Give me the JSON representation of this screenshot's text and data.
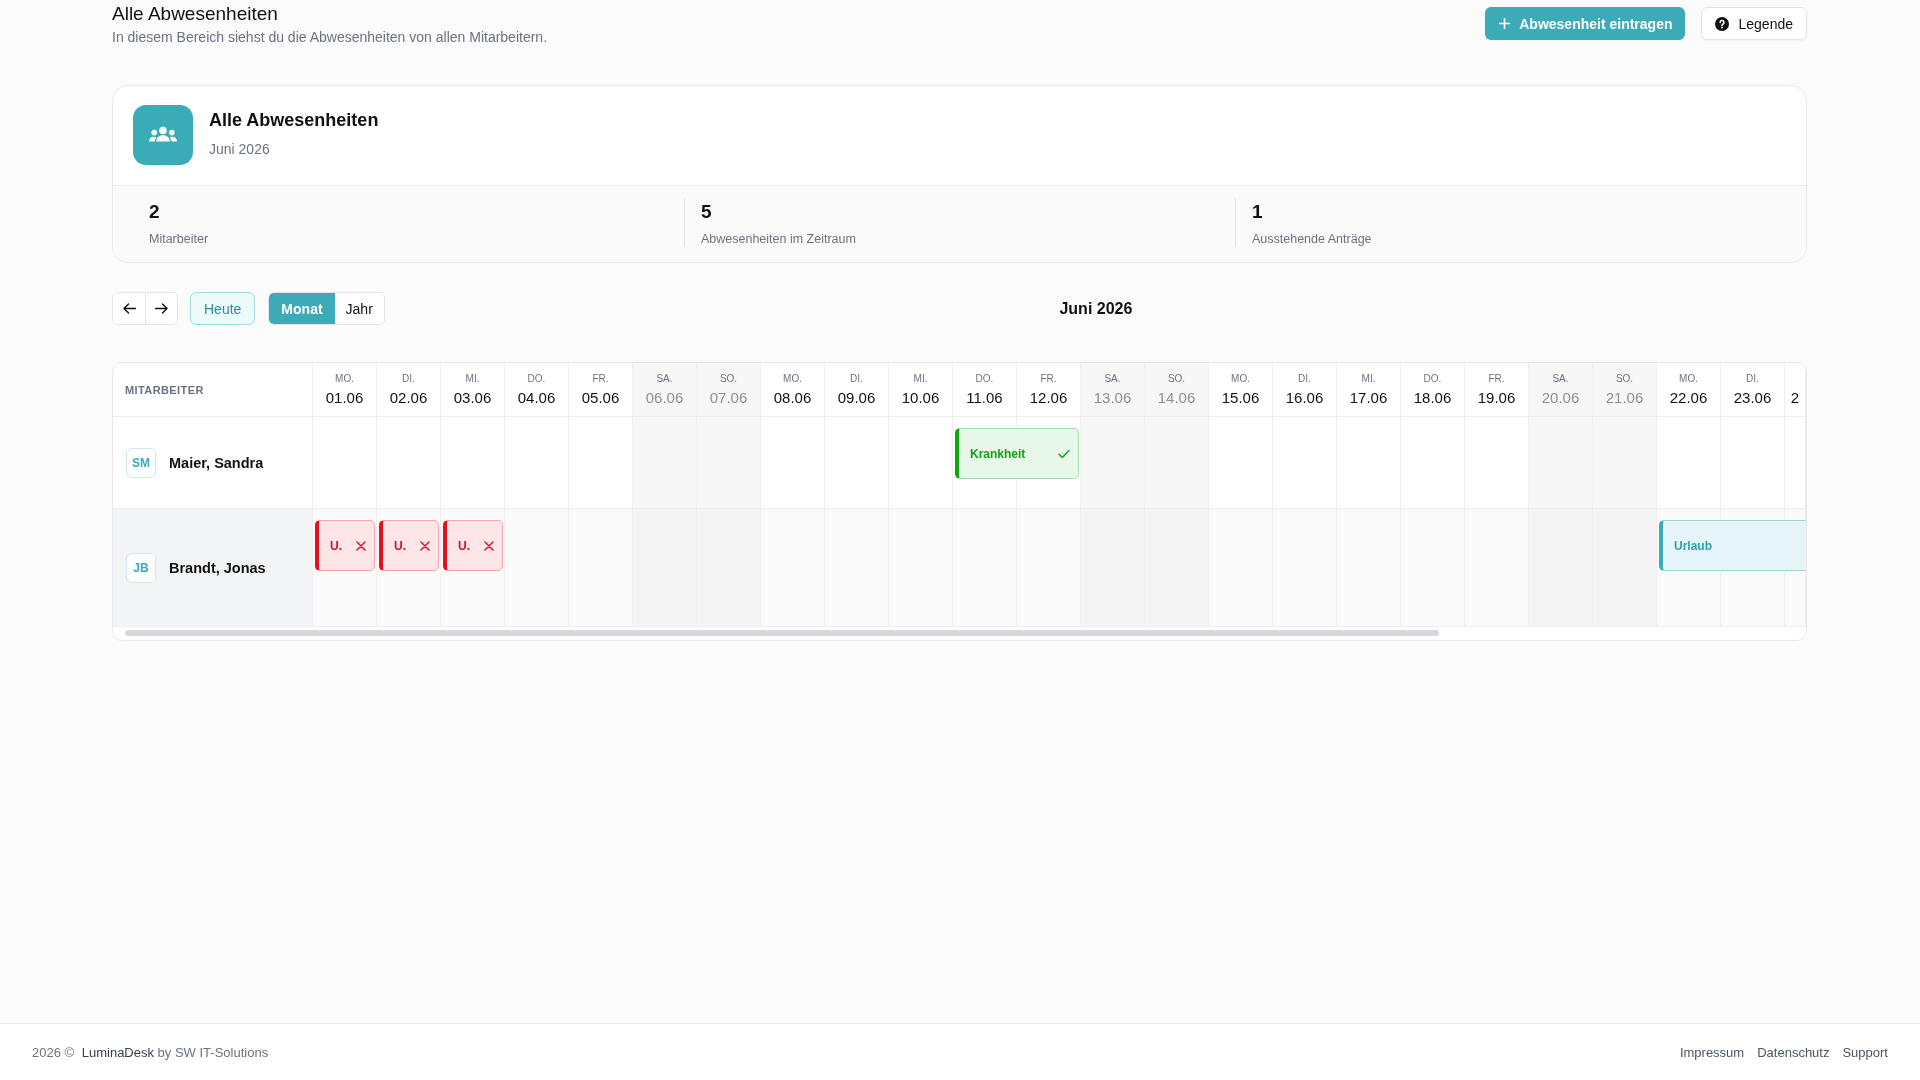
{
  "header": {
    "title": "Alle Abwesenheiten",
    "subtitle": "In diesem Bereich siehst du die Abwesenheiten von allen Mitarbeitern.",
    "actions": [
      {
        "label": "Abwesenheit eintragen",
        "kind": "primary"
      },
      {
        "label": "Legende",
        "kind": "help"
      }
    ]
  },
  "summary": {
    "title": "Alle Abwesenheiten",
    "period": "Juni 2026",
    "stats": [
      {
        "value": "2",
        "label": "Mitarbeiter"
      },
      {
        "value": "5",
        "label": "Abwesenheiten im Zeitraum"
      },
      {
        "value": "1",
        "label": "Ausstehende Anträge"
      }
    ]
  },
  "toolbar": {
    "today": "Heute",
    "views": [
      {
        "label": "Monat",
        "selected": true
      },
      {
        "label": "Jahr",
        "selected": false
      }
    ],
    "period": "Juni 2026"
  },
  "calendar": {
    "name_column": "MITARBEITER",
    "days": [
      {
        "weekday": "MO.",
        "date": "01.06",
        "weekend": false
      },
      {
        "weekday": "DI.",
        "date": "02.06",
        "weekend": false
      },
      {
        "weekday": "MI.",
        "date": "03.06",
        "weekend": false
      },
      {
        "weekday": "DO.",
        "date": "04.06",
        "weekend": false
      },
      {
        "weekday": "FR.",
        "date": "05.06",
        "weekend": false
      },
      {
        "weekday": "SA.",
        "date": "06.06",
        "weekend": true
      },
      {
        "weekday": "SO.",
        "date": "07.06",
        "weekend": true
      },
      {
        "weekday": "MO.",
        "date": "08.06",
        "weekend": false
      },
      {
        "weekday": "DI.",
        "date": "09.06",
        "weekend": false
      },
      {
        "weekday": "MI.",
        "date": "10.06",
        "weekend": false
      },
      {
        "weekday": "DO.",
        "date": "11.06",
        "weekend": false
      },
      {
        "weekday": "FR.",
        "date": "12.06",
        "weekend": false
      },
      {
        "weekday": "SA.",
        "date": "13.06",
        "weekend": true
      },
      {
        "weekday": "SO.",
        "date": "14.06",
        "weekend": true
      },
      {
        "weekday": "MO.",
        "date": "15.06",
        "weekend": false
      },
      {
        "weekday": "DI.",
        "date": "16.06",
        "weekend": false
      },
      {
        "weekday": "MI.",
        "date": "17.06",
        "weekend": false
      },
      {
        "weekday": "DO.",
        "date": "18.06",
        "weekend": false
      },
      {
        "weekday": "FR.",
        "date": "19.06",
        "weekend": false
      },
      {
        "weekday": "SA.",
        "date": "20.06",
        "weekend": true
      },
      {
        "weekday": "SO.",
        "date": "21.06",
        "weekend": true
      },
      {
        "weekday": "MO.",
        "date": "22.06",
        "weekend": false
      },
      {
        "weekday": "DI.",
        "date": "23.06",
        "weekend": false
      },
      {
        "date": "2",
        "weekend": false
      }
    ],
    "rows": [
      {
        "initials": "SM",
        "name": "Maier, Sandra",
        "highlighted": false,
        "cells": [
          {
            "kind": "empty"
          },
          {
            "kind": "empty"
          },
          {
            "kind": "empty"
          },
          {
            "kind": "empty"
          },
          {
            "kind": "empty"
          },
          {
            "kind": "empty"
          },
          {
            "kind": "empty"
          },
          {
            "kind": "empty"
          },
          {
            "kind": "empty"
          },
          {
            "kind": "empty"
          },
          {
            "kind": "approved",
            "label": "Krankheit"
          },
          {
            "kind": "continued"
          },
          {
            "kind": "empty"
          },
          {
            "kind": "empty"
          },
          {
            "kind": "empty"
          },
          {
            "kind": "empty"
          },
          {
            "kind": "empty"
          },
          {
            "kind": "empty"
          },
          {
            "kind": "empty"
          },
          {
            "kind": "empty"
          },
          {
            "kind": "empty"
          },
          {
            "kind": "empty"
          },
          {
            "kind": "empty"
          },
          {
            "kind": "empty"
          }
        ]
      },
      {
        "initials": "JB",
        "name": "Brandt, Jonas",
        "highlighted": true,
        "cells": [
          {
            "kind": "rejected",
            "label": "U."
          },
          {
            "kind": "rejected",
            "label": "U."
          },
          {
            "kind": "rejected",
            "label": "U."
          },
          {
            "kind": "empty"
          },
          {
            "kind": "empty"
          },
          {
            "kind": "empty"
          },
          {
            "kind": "empty"
          },
          {
            "kind": "empty"
          },
          {
            "kind": "empty"
          },
          {
            "kind": "empty"
          },
          {
            "kind": "empty"
          },
          {
            "kind": "empty"
          },
          {
            "kind": "empty"
          },
          {
            "kind": "empty"
          },
          {
            "kind": "empty"
          },
          {
            "kind": "empty"
          },
          {
            "kind": "empty"
          },
          {
            "kind": "empty"
          },
          {
            "kind": "empty"
          },
          {
            "kind": "empty"
          },
          {
            "kind": "empty"
          },
          {
            "kind": "pending",
            "label": "Urlaub"
          },
          {
            "kind": "continued"
          },
          {
            "kind": "continued"
          }
        ]
      }
    ]
  },
  "footer": {
    "copyright": "2026 ©",
    "brand": "LuminaDesk",
    "credit": "by SW IT-Solutions",
    "links": [
      "Impressum",
      "Datenschutz",
      "Support"
    ]
  }
}
